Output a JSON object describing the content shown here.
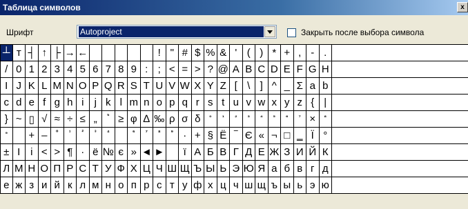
{
  "window": {
    "title": "Таблица символов",
    "close_label": "x"
  },
  "toolbar": {
    "font_label": "Шрифт",
    "font_value": "Autoproject",
    "close_after_select_label": "Закрыть после выбора символа",
    "close_after_select_checked": false
  },
  "grid": {
    "selected": [
      0,
      0
    ],
    "rows": [
      [
        "┴",
        "т",
        "┤",
        "↑",
        "├",
        "→",
        "←",
        "",
        "",
        "",
        "",
        "",
        "!",
        "\"",
        "#",
        "$",
        "%",
        "&",
        "'",
        "(",
        ")",
        "*",
        "+",
        ",",
        "-",
        "."
      ],
      [
        "/",
        "0",
        "1",
        "2",
        "3",
        "4",
        "5",
        "6",
        "7",
        "8",
        "9",
        ":",
        ";",
        "<",
        "=",
        ">",
        "?",
        "@",
        "A",
        "B",
        "C",
        "D",
        "E",
        "F",
        "G",
        "H"
      ],
      [
        "I",
        "J",
        "K",
        "L",
        "M",
        "N",
        "O",
        "P",
        "Q",
        "R",
        "S",
        "T",
        "U",
        "V",
        "W",
        "X",
        "Y",
        "Z",
        "[",
        "\\",
        "]",
        "^",
        "_",
        "Σ",
        "a",
        "b"
      ],
      [
        "c",
        "d",
        "e",
        "f",
        "g",
        "h",
        "i",
        "j",
        "k",
        "l",
        "m",
        "n",
        "o",
        "p",
        "q",
        "r",
        "s",
        "t",
        "u",
        "v",
        "w",
        "x",
        "y",
        "z",
        "{",
        "|"
      ],
      [
        "}",
        "~",
        "▯",
        "√",
        "≈",
        "÷",
        "≤",
        "„",
        "⁵",
        "≥",
        "φ",
        "∆",
        "‰",
        "ρ",
        "σ",
        "δ",
        "₀",
        "₁",
        "₂",
        "₃",
        "₄",
        "₅",
        "₆",
        "₇",
        "×",
        "₈"
      ],
      [
        "₉",
        "",
        "+",
        "–",
        "⁰",
        "¹",
        "²",
        "³",
        "⁴",
        "",
        "⁶",
        "⁷",
        "⁸",
        "⁹",
        "·",
        "+",
        "§",
        "Ё",
        "‾",
        "Є",
        "«",
        "¬",
        "□",
        "‗",
        "Ї",
        "°"
      ],
      [
        "±",
        "I",
        "i",
        "<",
        ">",
        "¶",
        "·",
        "ё",
        "№",
        "є",
        "»",
        "◄",
        "►",
        "",
        "ї",
        "А",
        "Б",
        "В",
        "Г",
        "Д",
        "Е",
        "Ж",
        "З",
        "И",
        "Й",
        "К"
      ],
      [
        "Л",
        "М",
        "Н",
        "О",
        "П",
        "Р",
        "С",
        "Т",
        "У",
        "Ф",
        "Х",
        "Ц",
        "Ч",
        "Ш",
        "Щ",
        "Ъ",
        "Ы",
        "Ь",
        "Э",
        "Ю",
        "Я",
        "а",
        "б",
        "в",
        "г",
        "д"
      ],
      [
        "е",
        "ж",
        "з",
        "и",
        "й",
        "к",
        "л",
        "м",
        "н",
        "о",
        "п",
        "р",
        "с",
        "т",
        "у",
        "ф",
        "х",
        "ц",
        "ч",
        "ш",
        "щ",
        "ъ",
        "ы",
        "ь",
        "э",
        "ю"
      ]
    ]
  }
}
